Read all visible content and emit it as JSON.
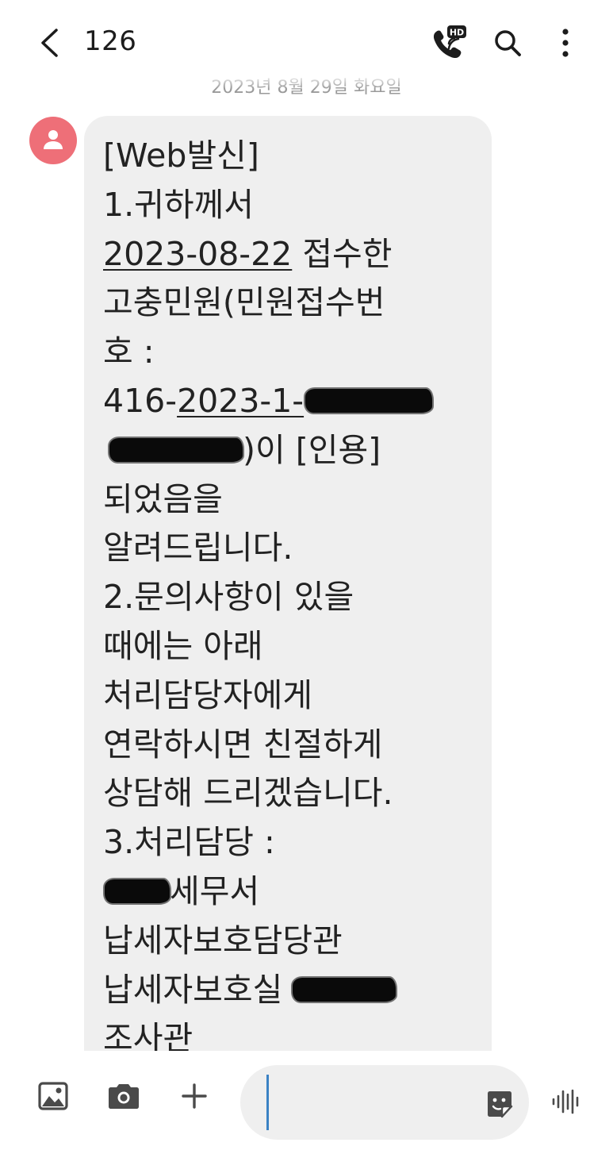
{
  "header": {
    "title": "126",
    "date_separator": "2023년 8월 29일 화요일"
  },
  "message": {
    "lines": [
      "[Web발신]",
      "1.귀하께서",
      "2023-08-22 접수한",
      "고충민원(민원접수번",
      "호 :",
      "416-2023-1-",
      ")이 [인용]",
      "되었음을",
      "알려드립니다.",
      "2.문의사항이 있을",
      "때에는 아래",
      "처리담당자에게",
      "연락하시면 친절하게",
      "상담해 드리겠습니다.",
      "3.처리담당 :",
      "세무서",
      "납세자보호담당관",
      "납세자보호실",
      "조사관"
    ],
    "date_part": "2023-08-22",
    "date_suffix": " 접수한",
    "case_prefix": "416-",
    "case_underlined": "2023-1-",
    "case_suffix": ")이 [인용]",
    "office_suffix": "세무서",
    "room_prefix": "납세자보호실 "
  },
  "composer": {
    "input_value": ""
  },
  "icons": {
    "back": "chevron-left-icon",
    "call": "hd-call-icon",
    "search": "search-icon",
    "more": "more-vertical-icon",
    "gallery": "image-icon",
    "camera": "camera-icon",
    "add": "plus-icon",
    "sticker": "sticker-icon",
    "voice": "voice-wave-icon"
  },
  "colors": {
    "avatar": "#ee6f78",
    "bubble": "#efefef",
    "caret": "#3b82c4"
  }
}
